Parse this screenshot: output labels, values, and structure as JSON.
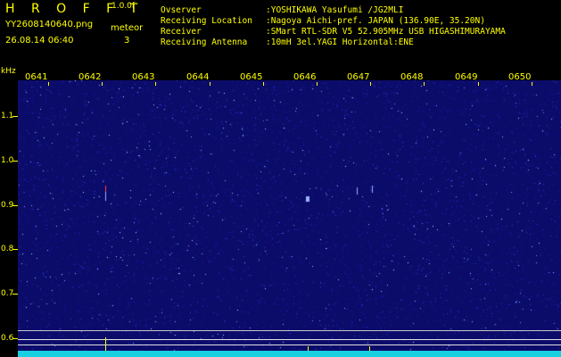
{
  "header": {
    "app_title": "H R O F F T",
    "version": "1.0.0f",
    "filename": "YY2608140640.png",
    "datetime": "26.08.14 06:40",
    "meteor_label": "meteor",
    "meteor_count": "3",
    "info": [
      {
        "label": "Ovserver",
        "value": ":YOSHIKAWA Yasufumi /JG2MLI"
      },
      {
        "label": "Receiving Location",
        "value": ":Nagoya Aichi-pref. JAPAN (136.90E, 35.20N)"
      },
      {
        "label": "Receiver",
        "value": ":SMart RTL-SDR V5 52.905MHz USB HIGASHIMURAYAMA"
      },
      {
        "label": "Receiving Antenna",
        "value": ":10mH 3el.YAGI Horizontal:ENE"
      }
    ]
  },
  "axis": {
    "y_unit": "kHz",
    "y_ticks": [
      "1.1",
      "1.0",
      "0.9",
      "0.8",
      "0.7",
      "0.6"
    ],
    "x_ticks": [
      "0641",
      "0642",
      "0643",
      "0644",
      "0645",
      "0646",
      "0647",
      "0648",
      "0649",
      "0650"
    ]
  },
  "colors": {
    "text": "#ffff00",
    "background": "#000000",
    "spectrogram_bg": "#0b0c6a",
    "baseline": "#18d0e0"
  }
}
